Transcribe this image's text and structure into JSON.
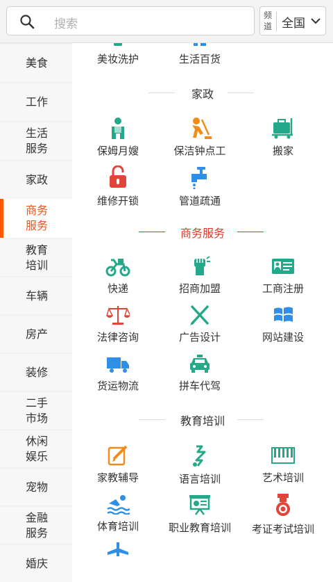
{
  "search": {
    "placeholder": "搜索"
  },
  "channel": {
    "label": "频道",
    "value": "全国"
  },
  "sidebar": {
    "items": [
      {
        "label": "美食"
      },
      {
        "label": "工作"
      },
      {
        "label": "生活服务"
      },
      {
        "label": "家政"
      },
      {
        "label": "商务服务",
        "active": true
      },
      {
        "label": "教育培训"
      },
      {
        "label": "车辆"
      },
      {
        "label": "房产"
      },
      {
        "label": "装修"
      },
      {
        "label": "二手市场"
      },
      {
        "label": "休闲娱乐"
      },
      {
        "label": "宠物"
      },
      {
        "label": "金融服务"
      },
      {
        "label": "婚庆"
      }
    ]
  },
  "top_partial": [
    {
      "label": "美妆洗护",
      "icon": "beauty-icon"
    },
    {
      "label": "生活百货",
      "icon": "goods-icon"
    }
  ],
  "sections": {
    "jiazheng": {
      "title": "家政",
      "items": [
        {
          "label": "保姆月嫂",
          "icon": "nanny-icon"
        },
        {
          "label": "保洁钟点工",
          "icon": "cleaner-icon"
        },
        {
          "label": "搬家",
          "icon": "moving-cart-icon"
        },
        {
          "label": "维修开锁",
          "icon": "unlock-icon"
        },
        {
          "label": "管道疏通",
          "icon": "faucet-icon"
        }
      ]
    },
    "shangwu": {
      "title": "商务服务",
      "items": [
        {
          "label": "快递",
          "icon": "motorbike-icon"
        },
        {
          "label": "招商加盟",
          "icon": "fist-icon"
        },
        {
          "label": "工商注册",
          "icon": "id-card-icon"
        },
        {
          "label": "法律咨询",
          "icon": "scales-icon"
        },
        {
          "label": "广告设计",
          "icon": "design-tools-icon"
        },
        {
          "label": "网站建设",
          "icon": "windows-icon"
        },
        {
          "label": "货运物流",
          "icon": "truck-icon"
        },
        {
          "label": "拼车代驾",
          "icon": "taxi-icon"
        }
      ]
    },
    "jiaoyu": {
      "title": "教育培训",
      "items": [
        {
          "label": "家教辅导",
          "icon": "pencil-note-icon"
        },
        {
          "label": "语言培训",
          "icon": "language-icon"
        },
        {
          "label": "艺术培训",
          "icon": "piano-icon"
        },
        {
          "label": "体育培训",
          "icon": "swimmer-icon"
        },
        {
          "label": "职业教育培训",
          "icon": "presentation-icon"
        },
        {
          "label": "考证考试培训",
          "icon": "medal-icon"
        }
      ]
    }
  },
  "colors": {
    "accent": "#ff5a00",
    "teal": "#24a889",
    "orange": "#f08c1a",
    "red": "#e0453a",
    "blue": "#2f8fe6",
    "section_red": "#d9372a"
  }
}
